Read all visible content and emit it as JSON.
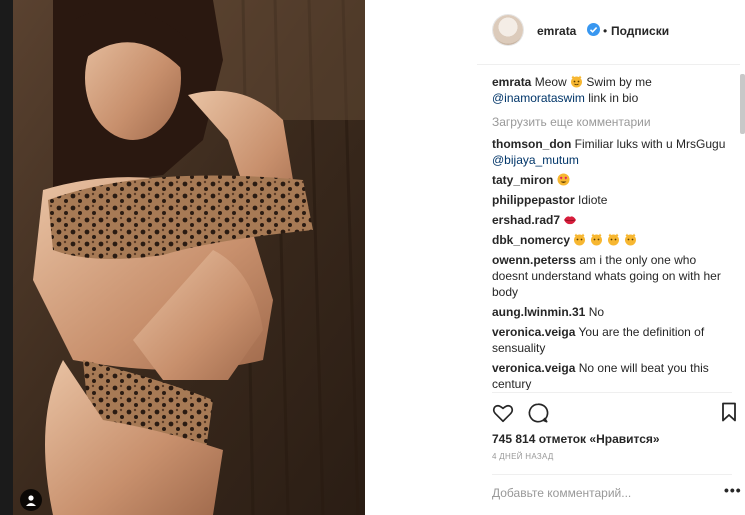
{
  "post": {
    "author": "emrata",
    "follow_dot": "•",
    "follow_label": "Подписки",
    "caption": {
      "user": "emrata",
      "text": "Meow",
      "emoji": "cat-face",
      "text2": "Swim by me",
      "mention": "@inamorataswim",
      "text3": "link in bio"
    },
    "load_more": "Загрузить еще комментарии",
    "comments": [
      {
        "user": "thomson_don",
        "text": "Fimiliar luks with u MrsGugu",
        "mention": "@bijaya_mutum"
      },
      {
        "user": "taty_miron",
        "emoji": "heart-eyes"
      },
      {
        "user": "philippepastor",
        "text": "Idiote"
      },
      {
        "user": "ershad.rad7",
        "emoji": "lips"
      },
      {
        "user": "dbk_nomercy",
        "emoji": "cat-face x4"
      },
      {
        "user": "owenn.peterss",
        "text": "am i the only one who doesnt understand whats going on with her body"
      },
      {
        "user": "aung.lwinmin.31",
        "text": "No"
      },
      {
        "user": "veronica.veiga",
        "text": "You are the definition of sensuality"
      },
      {
        "user": "veronica.veiga",
        "text": "No one will beat you this century"
      }
    ],
    "likes": "745 814 отметок «Нравится»",
    "time_ago": "4 ДНЕЙ НАЗАД",
    "add_comment_placeholder": "Добавьте комментарий...",
    "more_label": "•••"
  },
  "icons": {
    "like": "heart-outline-icon",
    "comment": "speech-bubble-icon",
    "save": "bookmark-icon",
    "verified": "verified-badge-icon",
    "user_tag": "person-tag-icon"
  },
  "colors": {
    "text": "#262626",
    "muted": "#999999",
    "mention": "#003569",
    "verified": "#3897f0",
    "emoji_yellow": "#f7b731",
    "lips": "#d81e3c"
  }
}
